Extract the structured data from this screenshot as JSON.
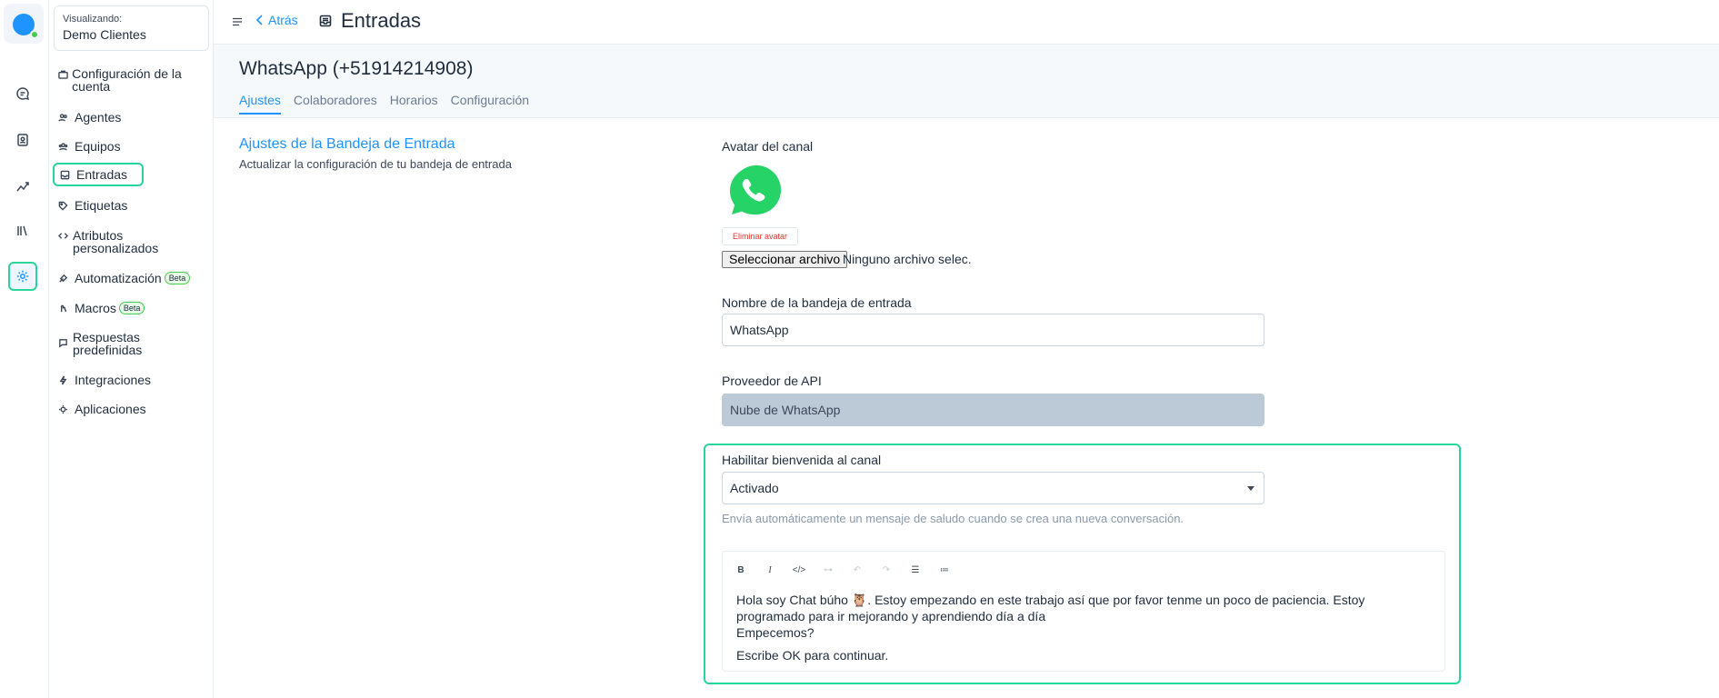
{
  "account": {
    "caption": "Visualizando:",
    "name": "Demo Clientes"
  },
  "topbar": {
    "back_label": "Atrás",
    "title": "Entradas"
  },
  "sidebar": {
    "items": [
      {
        "label": "Configuración de la cuenta",
        "icon": "briefcase-icon"
      },
      {
        "label": "Agentes",
        "icon": "people-icon"
      },
      {
        "label": "Equipos",
        "icon": "team-icon"
      },
      {
        "label": "Entradas",
        "icon": "inbox-icon"
      },
      {
        "label": "Etiquetas",
        "icon": "tag-icon"
      },
      {
        "label": "Atributos personalizados",
        "icon": "code-icon"
      },
      {
        "label": "Automatización",
        "icon": "automation-icon",
        "badge": "Beta"
      },
      {
        "label": "Macros",
        "icon": "macros-icon",
        "badge": "Beta"
      },
      {
        "label": "Respuestas predefinidas",
        "icon": "chat-icon"
      },
      {
        "label": "Integraciones",
        "icon": "flash-icon"
      },
      {
        "label": "Aplicaciones",
        "icon": "apps-icon"
      }
    ]
  },
  "inbox": {
    "title": "WhatsApp (+51914214908)",
    "tabs": [
      "Ajustes",
      "Colaboradores",
      "Horarios",
      "Configuración"
    ]
  },
  "settings": {
    "section_title": "Ajustes de la Bandeja de Entrada",
    "section_sub": "Actualizar la configuración de tu bandeja de entrada",
    "avatar_label": "Avatar del canal",
    "remove_avatar": "Eliminar avatar",
    "file_button": "Seleccionar archivo",
    "file_status": "Ninguno archivo selec.",
    "name_label": "Nombre de la bandeja de entrada",
    "name_value": "WhatsApp",
    "provider_label": "Proveedor de API",
    "provider_value": "Nube de WhatsApp",
    "welcome_label": "Habilitar bienvenida al canal",
    "welcome_value": "Activado",
    "welcome_help": "Envía automáticamente un mensaje de saludo cuando se crea una nueva conversación.",
    "editor_lines": [
      "Hola soy Chat búho 🦉. Estoy empezando en este trabajo así que por favor tenme un poco de paciencia. Estoy programado para ir mejorando y aprendiendo día a día",
      "Empecemos?",
      "Escribe OK para continuar."
    ]
  },
  "colors": {
    "accent": "#1f93ff",
    "highlight": "#2ad599",
    "whatsapp": "#25d366",
    "danger": "#e0342c"
  }
}
